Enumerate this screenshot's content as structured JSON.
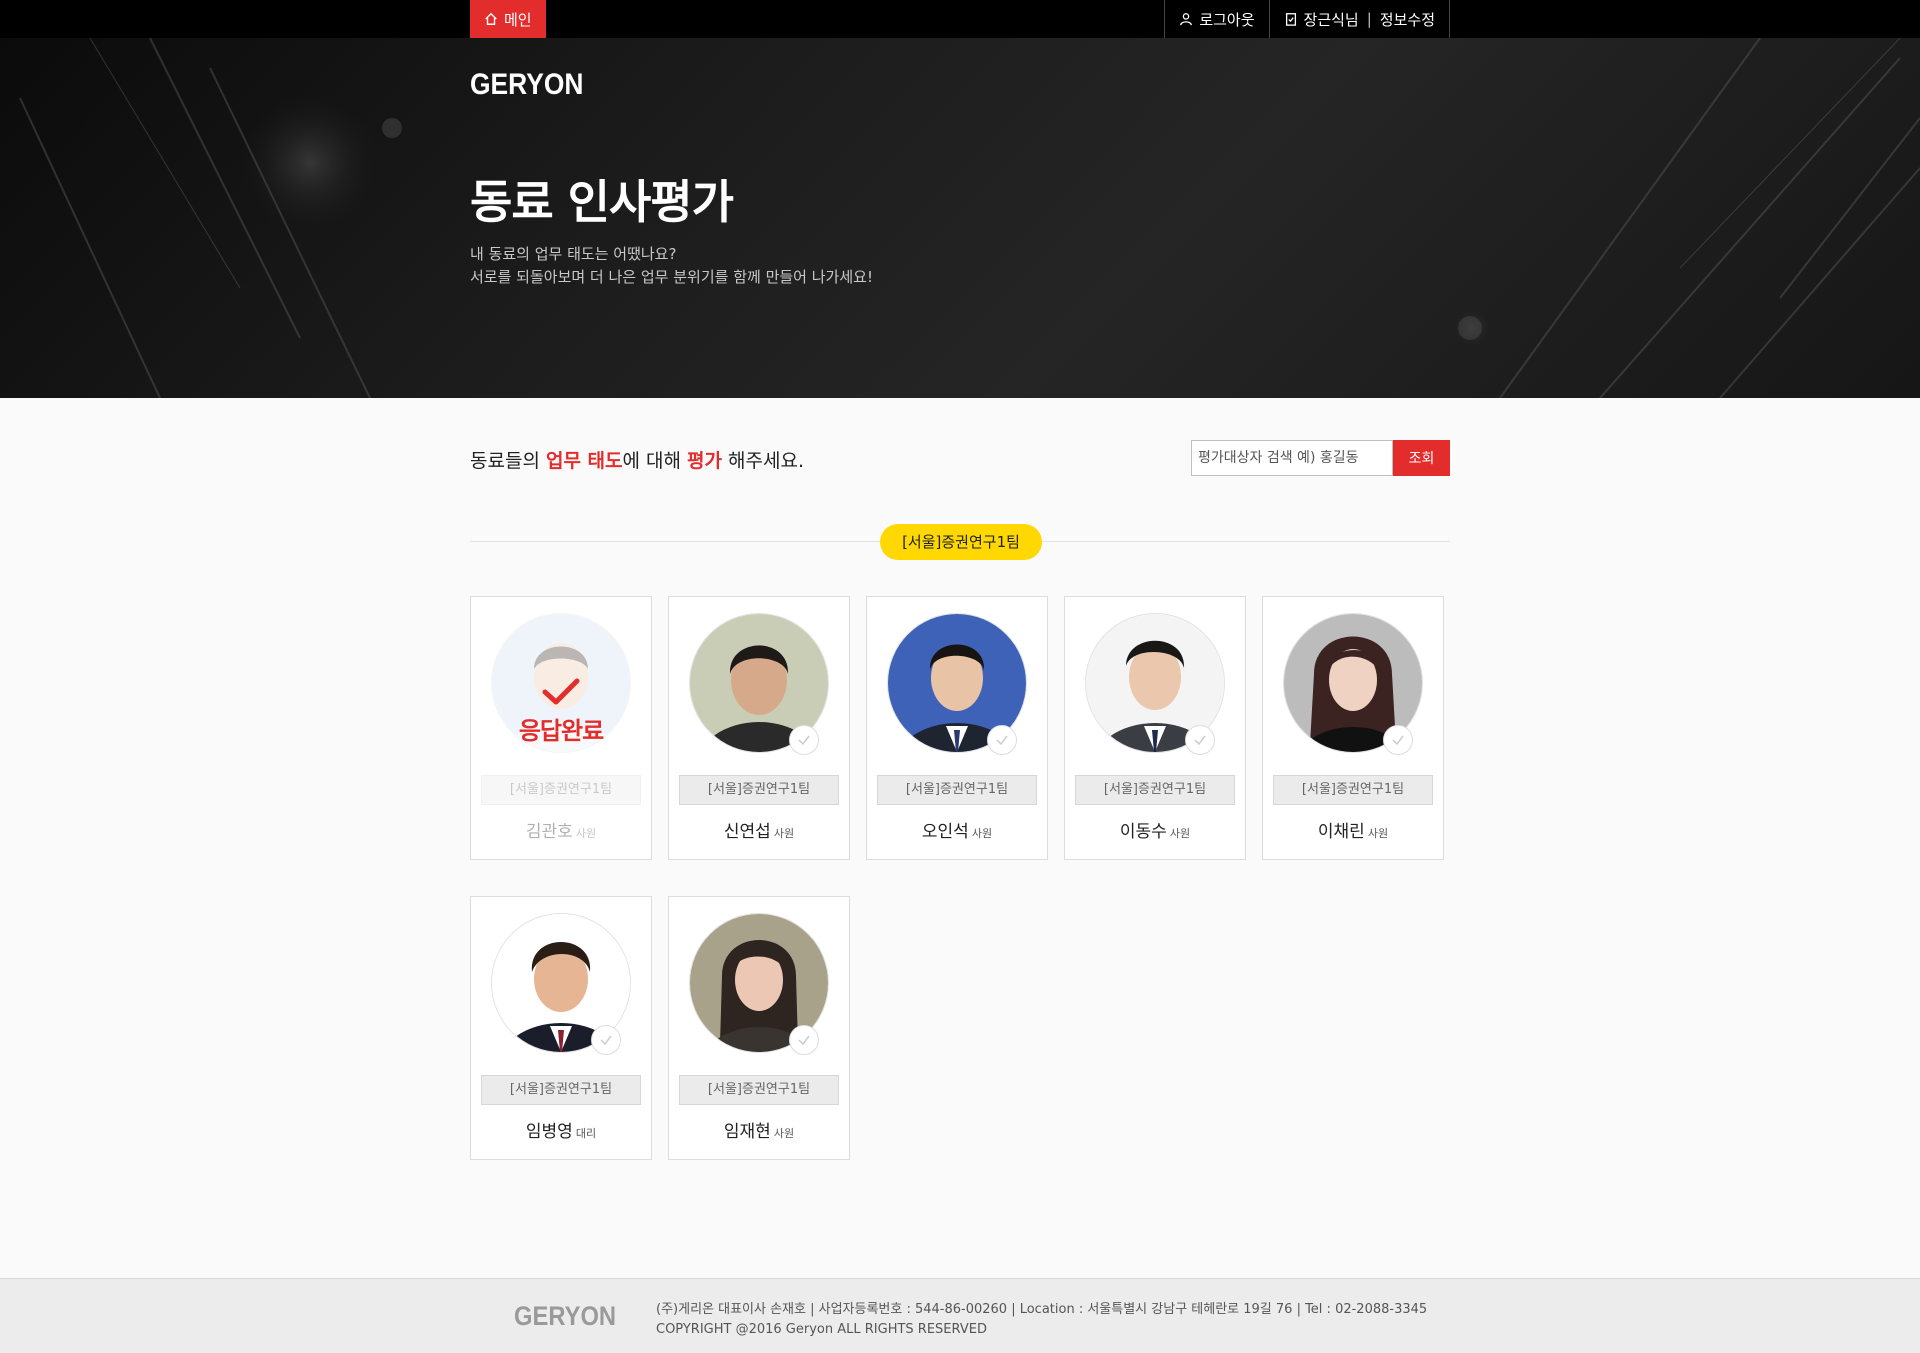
{
  "topbar": {
    "main_label": "메인",
    "logout_label": "로그아웃",
    "user_label": "장근식님",
    "separator": "|",
    "edit_label": "정보수정"
  },
  "hero": {
    "logo": "GERYON",
    "title": "동료 인사평가",
    "subtitle_line1": "내 동료의 업무 태도는 어땠나요?",
    "subtitle_line2": "서로를 되돌아보며 더 나은 업무 분위기를 함께 만들어 나가세요!"
  },
  "intro": {
    "part1": "동료들의 ",
    "highlight1": "업무 태도",
    "part2": "에 대해 ",
    "highlight2": "평가",
    "part3": " 해주세요."
  },
  "search": {
    "placeholder": "평가대상자 검색 예) 홍길동",
    "button_label": "조회"
  },
  "team_badge": "[서울]증권연구1팀",
  "done_label": "응답완료",
  "people": [
    {
      "name": "김관호",
      "rank": "사원",
      "team": "[서울]증권연구1팀",
      "status": "done"
    },
    {
      "name": "신연섭",
      "rank": "사원",
      "team": "[서울]증권연구1팀",
      "status": "pending"
    },
    {
      "name": "오인석",
      "rank": "사원",
      "team": "[서울]증권연구1팀",
      "status": "pending"
    },
    {
      "name": "이동수",
      "rank": "사원",
      "team": "[서울]증권연구1팀",
      "status": "pending"
    },
    {
      "name": "이채린",
      "rank": "사원",
      "team": "[서울]증권연구1팀",
      "status": "pending"
    },
    {
      "name": "임병영",
      "rank": "대리",
      "team": "[서울]증권연구1팀",
      "status": "pending"
    },
    {
      "name": "임재현",
      "rank": "사원",
      "team": "[서울]증권연구1팀",
      "status": "pending"
    }
  ],
  "footer": {
    "logo": "GERYON",
    "info_line1": "(주)게리온 대표이사 손재호 | 사업자등록번호 : 544-86-00260 | Location : 서울특별시 강남구 테헤란로 19길 76 | Tel : 02-2088-3345",
    "info_line2": "COPYRIGHT @2016 Geryon ALL RIGHTS RESERVED"
  },
  "colors": {
    "accent_red": "#e32d2d",
    "badge_yellow": "#fed800",
    "topbar_bg": "#000000"
  }
}
